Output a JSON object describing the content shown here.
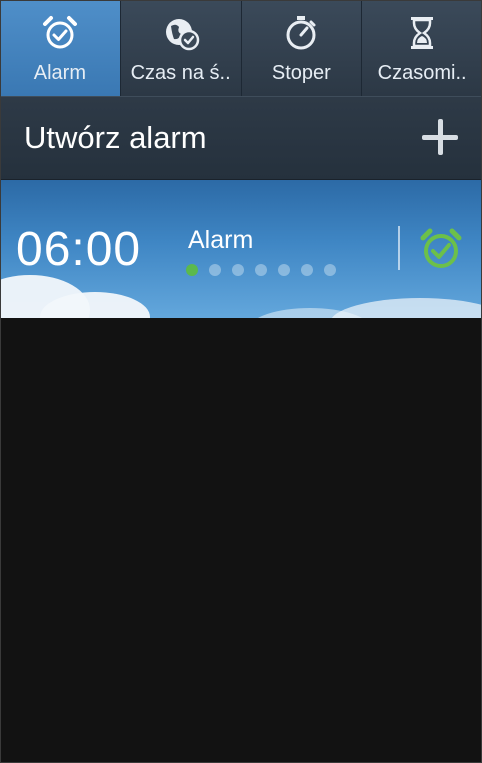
{
  "tabs": [
    {
      "label": "Alarm",
      "icon": "alarm-clock-icon",
      "active": true
    },
    {
      "label": "Czas na ś..",
      "icon": "world-clock-icon",
      "active": false
    },
    {
      "label": "Stoper",
      "icon": "stopwatch-icon",
      "active": false
    },
    {
      "label": "Czasomi..",
      "icon": "hourglass-icon",
      "active": false
    }
  ],
  "create_alarm": {
    "label": "Utwórz alarm",
    "add_icon": "plus-icon"
  },
  "alarms": [
    {
      "time": "06:00",
      "name": "Alarm",
      "days_active": [
        true,
        false,
        false,
        false,
        false,
        false,
        false
      ],
      "enabled": true,
      "status_icon": "alarm-clock-icon"
    }
  ],
  "colors": {
    "active_tab": "#3a78b3",
    "enabled_alarm": "#6cc04a",
    "day_dot_active": "#5bb94d"
  }
}
